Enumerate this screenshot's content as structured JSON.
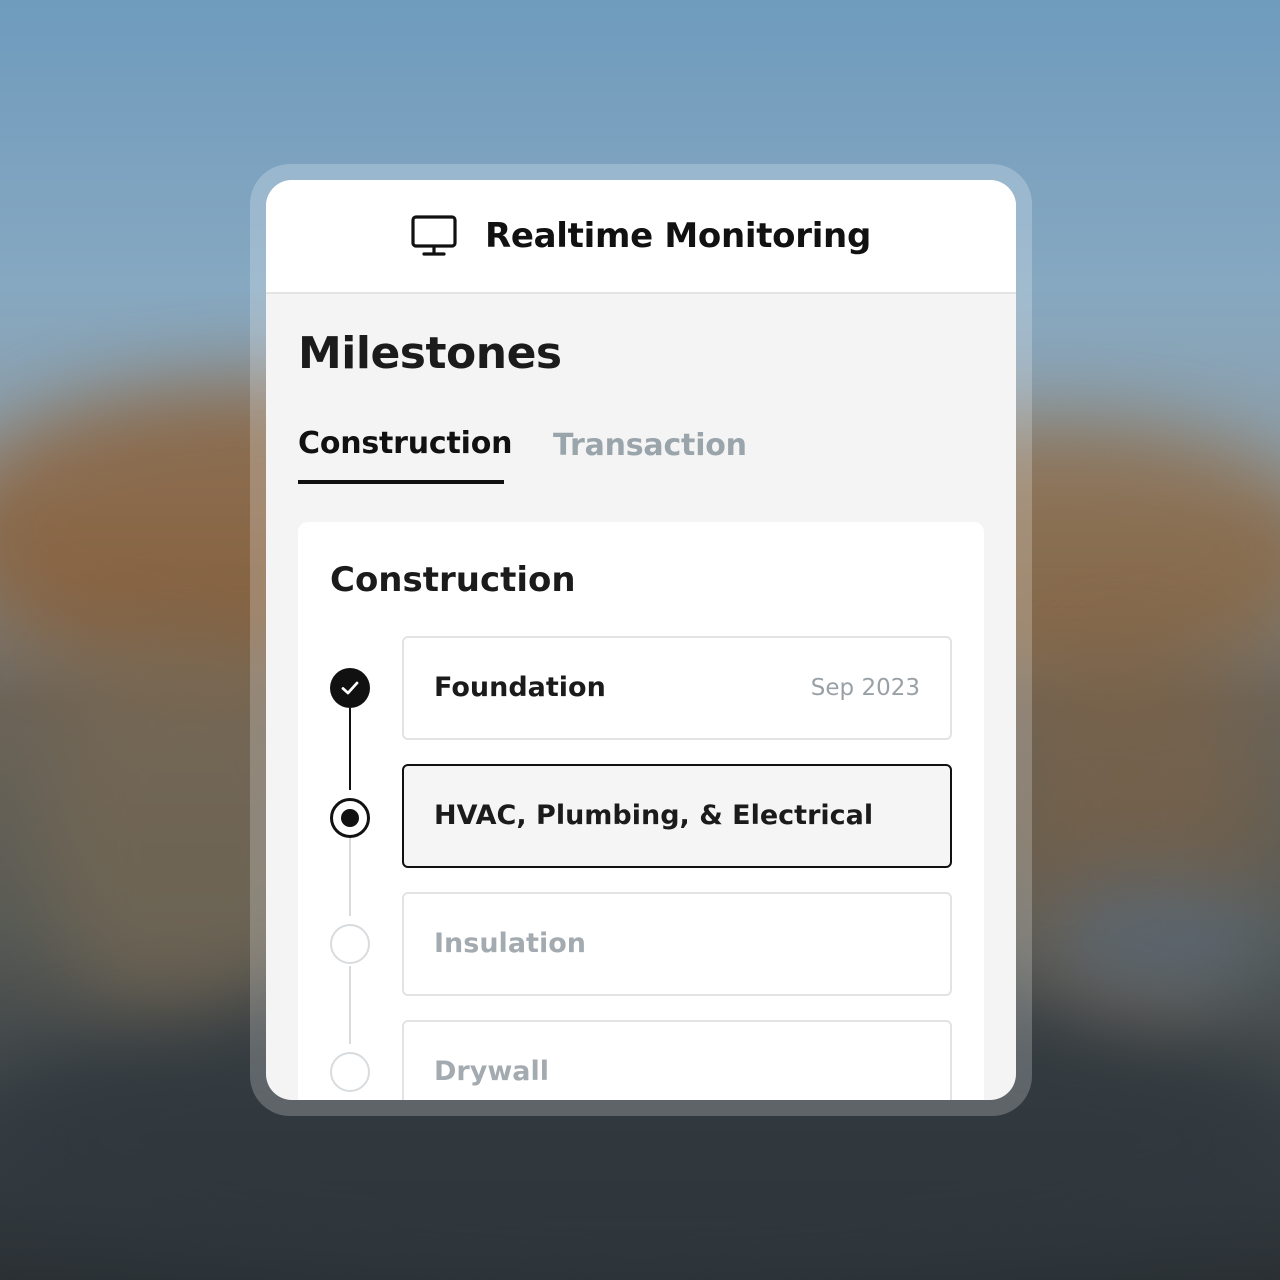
{
  "header": {
    "icon": "monitor-icon",
    "title": "Realtime Monitoring"
  },
  "page_title": "Milestones",
  "tabs": [
    {
      "label": "Construction",
      "active": true
    },
    {
      "label": "Transaction",
      "active": false
    }
  ],
  "panel": {
    "title": "Construction",
    "steps": [
      {
        "label": "Foundation",
        "date": "Sep 2023",
        "status": "completed",
        "icon": "check-icon"
      },
      {
        "label": "HVAC, Plumbing, & Electrical",
        "date": "",
        "status": "current"
      },
      {
        "label": "Insulation",
        "date": "",
        "status": "pending"
      },
      {
        "label": "Drywall",
        "date": "",
        "status": "pending"
      }
    ]
  },
  "colors": {
    "active": "#111111",
    "muted": "#9aa4ab",
    "card_background": "#f4f4f4"
  }
}
